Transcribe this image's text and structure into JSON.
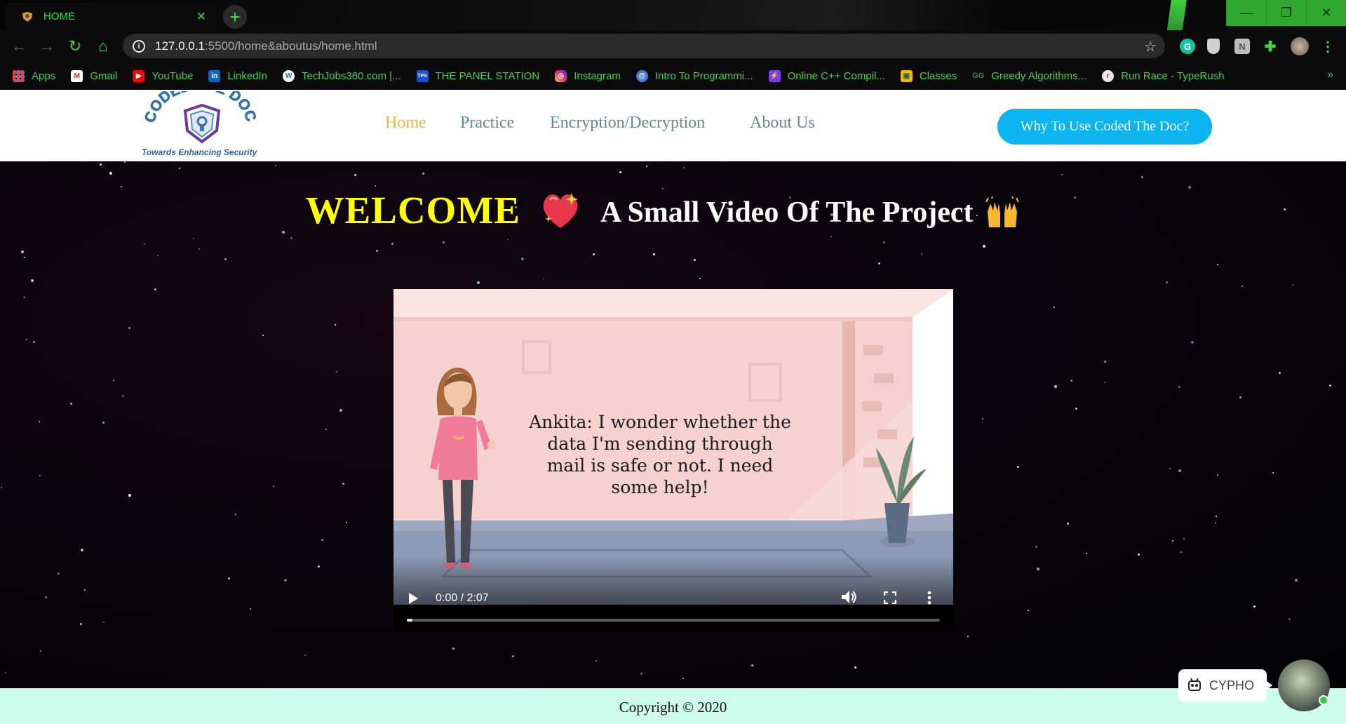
{
  "browser": {
    "tab": {
      "title": "HOME",
      "close_glyph": "✕"
    },
    "new_tab_glyph": "+",
    "window_controls": {
      "minimize": "—",
      "restore": "❐",
      "close": "✕"
    },
    "nav": {
      "back": "←",
      "forward": "→",
      "reload": "↻",
      "home": "⌂"
    },
    "address": {
      "host": "127.0.0.1",
      "path": ":5500/home&aboutus/home.html",
      "star": "☆"
    },
    "bookmarks": [
      {
        "label": "Apps",
        "icon": "apps-grid-icon",
        "color": "#e94235"
      },
      {
        "label": "Gmail",
        "icon": "gmail-icon",
        "color": "#ffffff"
      },
      {
        "label": "YouTube",
        "icon": "youtube-icon",
        "color": "#ff0000"
      },
      {
        "label": "LinkedIn",
        "icon": "linkedin-icon",
        "color": "#0a66c2"
      },
      {
        "label": "TechJobs360.com |...",
        "icon": "wordpress-icon",
        "color": "#ffffff"
      },
      {
        "label": "THE PANEL STATION",
        "icon": "tps-icon",
        "color": "#1e50c8"
      },
      {
        "label": "Instagram",
        "icon": "instagram-icon",
        "color": "#d6249f"
      },
      {
        "label": "Intro To Programmi...",
        "icon": "globe-icon",
        "color": "#4a7bd8"
      },
      {
        "label": "Online C++ Compil...",
        "icon": "lightning-icon",
        "color": "#7b3fe4"
      },
      {
        "label": "Classes",
        "icon": "classroom-icon",
        "color": "#f4b400"
      },
      {
        "label": "Greedy Algorithms...",
        "icon": "gfg-icon",
        "color": "#2f8d46"
      },
      {
        "label": "Run Race - TypeRush",
        "icon": "typerush-icon",
        "color": "#e8e8e8"
      }
    ],
    "bookmarks_more": "»"
  },
  "site": {
    "logo": {
      "arc_text": "CODED THE DOC",
      "tagline": "Towards Enhancing Security"
    },
    "nav": [
      {
        "label": "Home",
        "active": true
      },
      {
        "label": "Practice",
        "active": false
      },
      {
        "label": "Encryption/Decryption",
        "active": false
      },
      {
        "label": "About Us",
        "active": false
      }
    ],
    "cta_label": "Why To Use Coded The Doc?",
    "headline": {
      "welcome": "WELCOME",
      "subtitle": "A Small Video Of The Project"
    },
    "video": {
      "caption": "Ankita: I wonder whether the data I'm sending through mail is safe or not. I need some help!",
      "time": "0:00 / 2:07",
      "progress": 0.0
    },
    "footer": "Copyright © 2020",
    "chatbot": {
      "label": "CYPHO"
    }
  },
  "colors": {
    "accent_green": "#34e034",
    "nav_active": "#f7b733",
    "nav_link": "#5f8f8f",
    "cta_blue": "#0cb4f0",
    "welcome_yellow": "#ffff00",
    "footer_bg": "#cdfbec"
  }
}
